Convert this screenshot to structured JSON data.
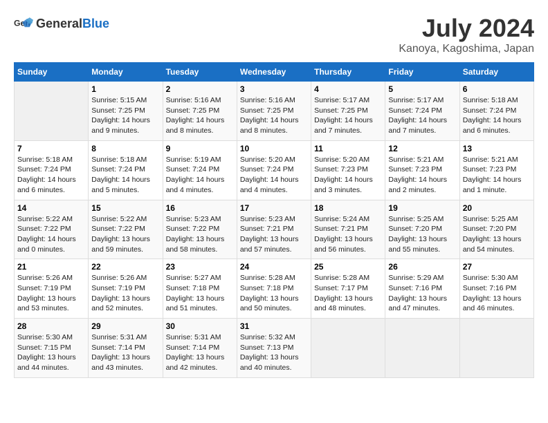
{
  "header": {
    "logo_general": "General",
    "logo_blue": "Blue",
    "month_title": "July 2024",
    "location": "Kanoya, Kagoshima, Japan"
  },
  "days_of_week": [
    "Sunday",
    "Monday",
    "Tuesday",
    "Wednesday",
    "Thursday",
    "Friday",
    "Saturday"
  ],
  "weeks": [
    [
      {
        "day": "",
        "info": ""
      },
      {
        "day": "1",
        "info": "Sunrise: 5:15 AM\nSunset: 7:25 PM\nDaylight: 14 hours\nand 9 minutes."
      },
      {
        "day": "2",
        "info": "Sunrise: 5:16 AM\nSunset: 7:25 PM\nDaylight: 14 hours\nand 8 minutes."
      },
      {
        "day": "3",
        "info": "Sunrise: 5:16 AM\nSunset: 7:25 PM\nDaylight: 14 hours\nand 8 minutes."
      },
      {
        "day": "4",
        "info": "Sunrise: 5:17 AM\nSunset: 7:25 PM\nDaylight: 14 hours\nand 7 minutes."
      },
      {
        "day": "5",
        "info": "Sunrise: 5:17 AM\nSunset: 7:24 PM\nDaylight: 14 hours\nand 7 minutes."
      },
      {
        "day": "6",
        "info": "Sunrise: 5:18 AM\nSunset: 7:24 PM\nDaylight: 14 hours\nand 6 minutes."
      }
    ],
    [
      {
        "day": "7",
        "info": "Sunrise: 5:18 AM\nSunset: 7:24 PM\nDaylight: 14 hours\nand 6 minutes."
      },
      {
        "day": "8",
        "info": "Sunrise: 5:18 AM\nSunset: 7:24 PM\nDaylight: 14 hours\nand 5 minutes."
      },
      {
        "day": "9",
        "info": "Sunrise: 5:19 AM\nSunset: 7:24 PM\nDaylight: 14 hours\nand 4 minutes."
      },
      {
        "day": "10",
        "info": "Sunrise: 5:20 AM\nSunset: 7:24 PM\nDaylight: 14 hours\nand 4 minutes."
      },
      {
        "day": "11",
        "info": "Sunrise: 5:20 AM\nSunset: 7:23 PM\nDaylight: 14 hours\nand 3 minutes."
      },
      {
        "day": "12",
        "info": "Sunrise: 5:21 AM\nSunset: 7:23 PM\nDaylight: 14 hours\nand 2 minutes."
      },
      {
        "day": "13",
        "info": "Sunrise: 5:21 AM\nSunset: 7:23 PM\nDaylight: 14 hours\nand 1 minute."
      }
    ],
    [
      {
        "day": "14",
        "info": "Sunrise: 5:22 AM\nSunset: 7:22 PM\nDaylight: 14 hours\nand 0 minutes."
      },
      {
        "day": "15",
        "info": "Sunrise: 5:22 AM\nSunset: 7:22 PM\nDaylight: 13 hours\nand 59 minutes."
      },
      {
        "day": "16",
        "info": "Sunrise: 5:23 AM\nSunset: 7:22 PM\nDaylight: 13 hours\nand 58 minutes."
      },
      {
        "day": "17",
        "info": "Sunrise: 5:23 AM\nSunset: 7:21 PM\nDaylight: 13 hours\nand 57 minutes."
      },
      {
        "day": "18",
        "info": "Sunrise: 5:24 AM\nSunset: 7:21 PM\nDaylight: 13 hours\nand 56 minutes."
      },
      {
        "day": "19",
        "info": "Sunrise: 5:25 AM\nSunset: 7:20 PM\nDaylight: 13 hours\nand 55 minutes."
      },
      {
        "day": "20",
        "info": "Sunrise: 5:25 AM\nSunset: 7:20 PM\nDaylight: 13 hours\nand 54 minutes."
      }
    ],
    [
      {
        "day": "21",
        "info": "Sunrise: 5:26 AM\nSunset: 7:19 PM\nDaylight: 13 hours\nand 53 minutes."
      },
      {
        "day": "22",
        "info": "Sunrise: 5:26 AM\nSunset: 7:19 PM\nDaylight: 13 hours\nand 52 minutes."
      },
      {
        "day": "23",
        "info": "Sunrise: 5:27 AM\nSunset: 7:18 PM\nDaylight: 13 hours\nand 51 minutes."
      },
      {
        "day": "24",
        "info": "Sunrise: 5:28 AM\nSunset: 7:18 PM\nDaylight: 13 hours\nand 50 minutes."
      },
      {
        "day": "25",
        "info": "Sunrise: 5:28 AM\nSunset: 7:17 PM\nDaylight: 13 hours\nand 48 minutes."
      },
      {
        "day": "26",
        "info": "Sunrise: 5:29 AM\nSunset: 7:16 PM\nDaylight: 13 hours\nand 47 minutes."
      },
      {
        "day": "27",
        "info": "Sunrise: 5:30 AM\nSunset: 7:16 PM\nDaylight: 13 hours\nand 46 minutes."
      }
    ],
    [
      {
        "day": "28",
        "info": "Sunrise: 5:30 AM\nSunset: 7:15 PM\nDaylight: 13 hours\nand 44 minutes."
      },
      {
        "day": "29",
        "info": "Sunrise: 5:31 AM\nSunset: 7:14 PM\nDaylight: 13 hours\nand 43 minutes."
      },
      {
        "day": "30",
        "info": "Sunrise: 5:31 AM\nSunset: 7:14 PM\nDaylight: 13 hours\nand 42 minutes."
      },
      {
        "day": "31",
        "info": "Sunrise: 5:32 AM\nSunset: 7:13 PM\nDaylight: 13 hours\nand 40 minutes."
      },
      {
        "day": "",
        "info": ""
      },
      {
        "day": "",
        "info": ""
      },
      {
        "day": "",
        "info": ""
      }
    ]
  ]
}
